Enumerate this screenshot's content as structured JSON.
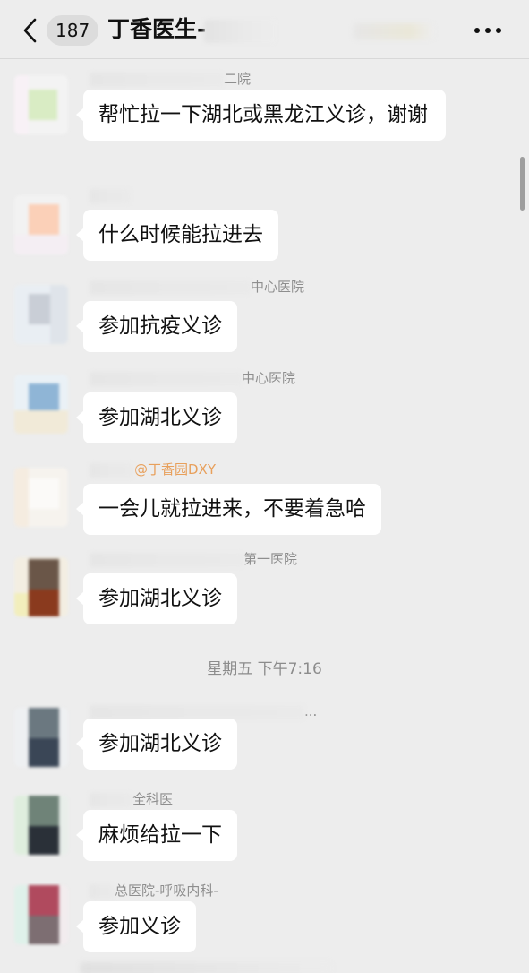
{
  "header": {
    "unread_count": "187",
    "title": "丁香医生-"
  },
  "messages": [
    {
      "sender_suffix": "二院",
      "text": "帮忙拉一下湖北或黑龙江义诊，谢谢"
    },
    {
      "sender_suffix": "",
      "text": "什么时候能拉进去"
    },
    {
      "sender_suffix": "中心医院",
      "text": "参加抗疫义诊"
    },
    {
      "sender_suffix": "中心医院",
      "text": "参加湖北义诊"
    },
    {
      "sender_suffix": "@丁香园DXY",
      "text": "一会儿就拉进来，不要着急哈"
    },
    {
      "sender_suffix": "第一医院",
      "text": "参加湖北义诊"
    },
    {
      "sender_suffix": "...",
      "text": "参加湖北义诊"
    },
    {
      "sender_suffix": "全科医",
      "text": "麻烦给拉一下"
    },
    {
      "sender_suffix": "总医院-呼吸内科-",
      "text": "参加义诊"
    }
  ],
  "timestamp": "星期五 下午7:16",
  "icons": {
    "back": "chevron-left-icon",
    "more": "more-dots-icon"
  },
  "colors": {
    "background": "#ededed",
    "bubble": "#ffffff",
    "admin_name": "#e8a05c"
  }
}
